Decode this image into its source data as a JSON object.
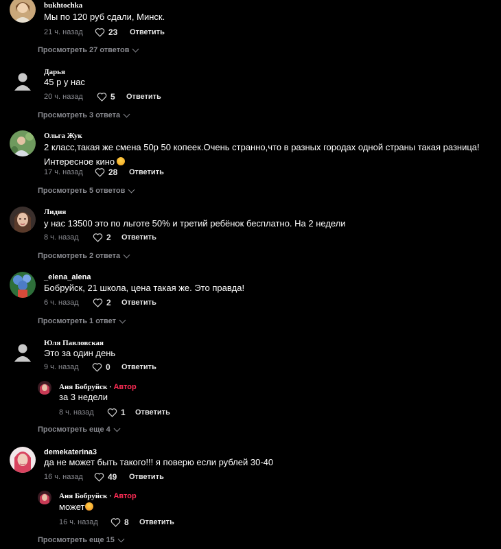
{
  "comments": [
    {
      "author": "bukhtochka",
      "text": "Мы по 120 руб сдали, Минск.",
      "time": "21 ч. назад",
      "likes": "23",
      "reply_label": "Ответить",
      "view_more": "Просмотреть 27 ответов"
    },
    {
      "author": "Дарья",
      "text": "45 р у нас",
      "time": "20 ч. назад",
      "likes": "5",
      "reply_label": "Ответить",
      "view_more": "Просмотреть 3 ответа"
    },
    {
      "author": "Ольга Жук",
      "text": "2 класс,такая же смена 50р 50 копеек.Очень странно,что в разных городах одной страны такая разница! Интересное кино",
      "time": "17 ч. назад",
      "likes": "28",
      "reply_label": "Ответить",
      "view_more": "Просмотреть 5 ответов"
    },
    {
      "author": "Лидия",
      "text": "у нас 13500 это по льготе 50% и третий ребёнок бесплатно. На 2 недели",
      "time": "8 ч. назад",
      "likes": "2",
      "reply_label": "Ответить",
      "view_more": "Просмотреть 2 ответа"
    },
    {
      "author": "_elena_alena",
      "text": "Бобруйск, 21 школа, цена такая же. Это правда!",
      "time": "6 ч. назад",
      "likes": "2",
      "reply_label": "Ответить",
      "view_more": "Просмотреть 1 ответ"
    },
    {
      "author": "Юля Павловская",
      "text": "Это за один день",
      "time": "9 ч. назад",
      "likes": "0",
      "reply_label": "Ответить",
      "reply": {
        "author": "Аня Бобруйск",
        "separator": "·",
        "badge": "Автор",
        "text": "за 3 недели",
        "time": "8 ч. назад",
        "likes": "1",
        "reply_label": "Ответить"
      },
      "view_more": "Просмотреть еще 4"
    },
    {
      "author": "demekaterina3",
      "text": "да не может быть такого!!! я поверю если рублей 30-40",
      "time": "16 ч. назад",
      "likes": "49",
      "reply_label": "Ответить",
      "reply": {
        "author": "Аня Бобруйск",
        "separator": "·",
        "badge": "Автор",
        "text": "может",
        "time": "16 ч. назад",
        "likes": "8",
        "reply_label": "Ответить"
      },
      "view_more": "Просмотреть еще 15"
    }
  ]
}
